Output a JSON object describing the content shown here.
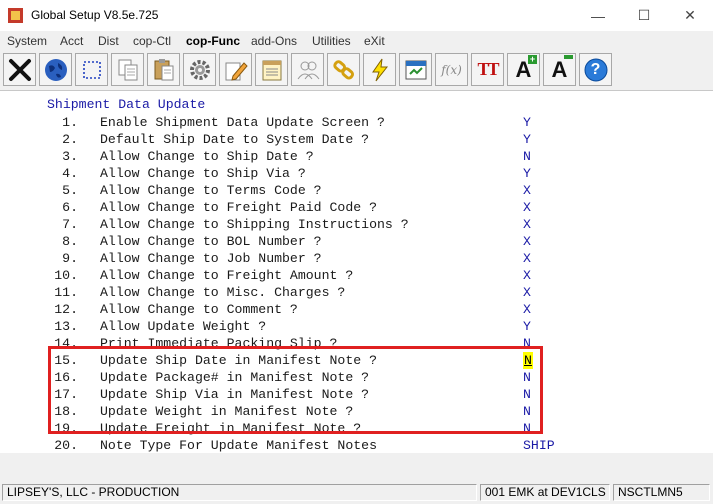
{
  "window": {
    "title": "Global Setup V8.5e.725",
    "minimize": "—",
    "maximize": "☐",
    "close": "✕"
  },
  "menu": [
    "System",
    "Acct",
    "Dist",
    "cop-Ctl",
    "cop-Func",
    "add-Ons",
    "Utilities",
    "eXit"
  ],
  "toolbar": [
    "exit-icon",
    "globe-icon",
    "select-icon",
    "copy-icon",
    "paste-icon",
    "settings-icon",
    "edit-icon",
    "notes-icon",
    "users-icon",
    "link-icon",
    "lightning-icon",
    "calendar-icon",
    "function-icon",
    "font-icon",
    "font-increase-icon",
    "font-decrease-icon",
    "help-icon"
  ],
  "toolbar_labels": {
    "font": "TT",
    "grow": "A",
    "shrink": "A",
    "help": "?",
    "fx": "f(x)"
  },
  "screen": {
    "heading": "Shipment Data Update",
    "rows": [
      {
        "num": "1.",
        "label": "Enable Shipment Data Update Screen ?",
        "value": "Y"
      },
      {
        "num": "2.",
        "label": "Default Ship Date to System Date ?",
        "value": "Y"
      },
      {
        "num": "3.",
        "label": "Allow Change to Ship Date ?",
        "value": "N"
      },
      {
        "num": "4.",
        "label": "Allow Change to Ship Via ?",
        "value": "Y"
      },
      {
        "num": "5.",
        "label": "Allow Change to Terms Code ?",
        "value": "X"
      },
      {
        "num": "6.",
        "label": "Allow Change to Freight Paid Code ?",
        "value": "X"
      },
      {
        "num": "7.",
        "label": "Allow Change to Shipping Instructions ?",
        "value": "X"
      },
      {
        "num": "8.",
        "label": "Allow Change to BOL Number ?",
        "value": "X"
      },
      {
        "num": "9.",
        "label": "Allow Change to Job Number ?",
        "value": "X"
      },
      {
        "num": "10.",
        "label": "Allow Change to Freight Amount ?",
        "value": "X"
      },
      {
        "num": "11.",
        "label": "Allow Change to Misc. Charges ?",
        "value": "X"
      },
      {
        "num": "12.",
        "label": "Allow Change to Comment ?",
        "value": "X"
      },
      {
        "num": "13.",
        "label": "Allow Update Weight ?",
        "value": "Y"
      },
      {
        "num": "14.",
        "label": "Print Immediate Packing Slip ?",
        "value": "N"
      },
      {
        "num": "15.",
        "label": "Update Ship Date in Manifest Note ?",
        "value": "N"
      },
      {
        "num": "16.",
        "label": "Update Package# in Manifest Note ?",
        "value": "N"
      },
      {
        "num": "17.",
        "label": "Update Ship Via in Manifest Note ?",
        "value": "N"
      },
      {
        "num": "18.",
        "label": "Update Weight in Manifest Note ?",
        "value": "N"
      },
      {
        "num": "19.",
        "label": "Update Freight in Manifest Note ?",
        "value": "N"
      },
      {
        "num": "20.",
        "label": "Note Type For Update Manifest Notes",
        "value": "SHIP"
      }
    ]
  },
  "status": {
    "company": "LIPSEY'S, LLC - PRODUCTION",
    "session": "001 EMK at DEV1CLS",
    "program": "NSCTLMN5"
  },
  "colors": {
    "highlight": "#ffff00",
    "annotation_box": "#e02020",
    "value_text": "#1a1aa6"
  }
}
